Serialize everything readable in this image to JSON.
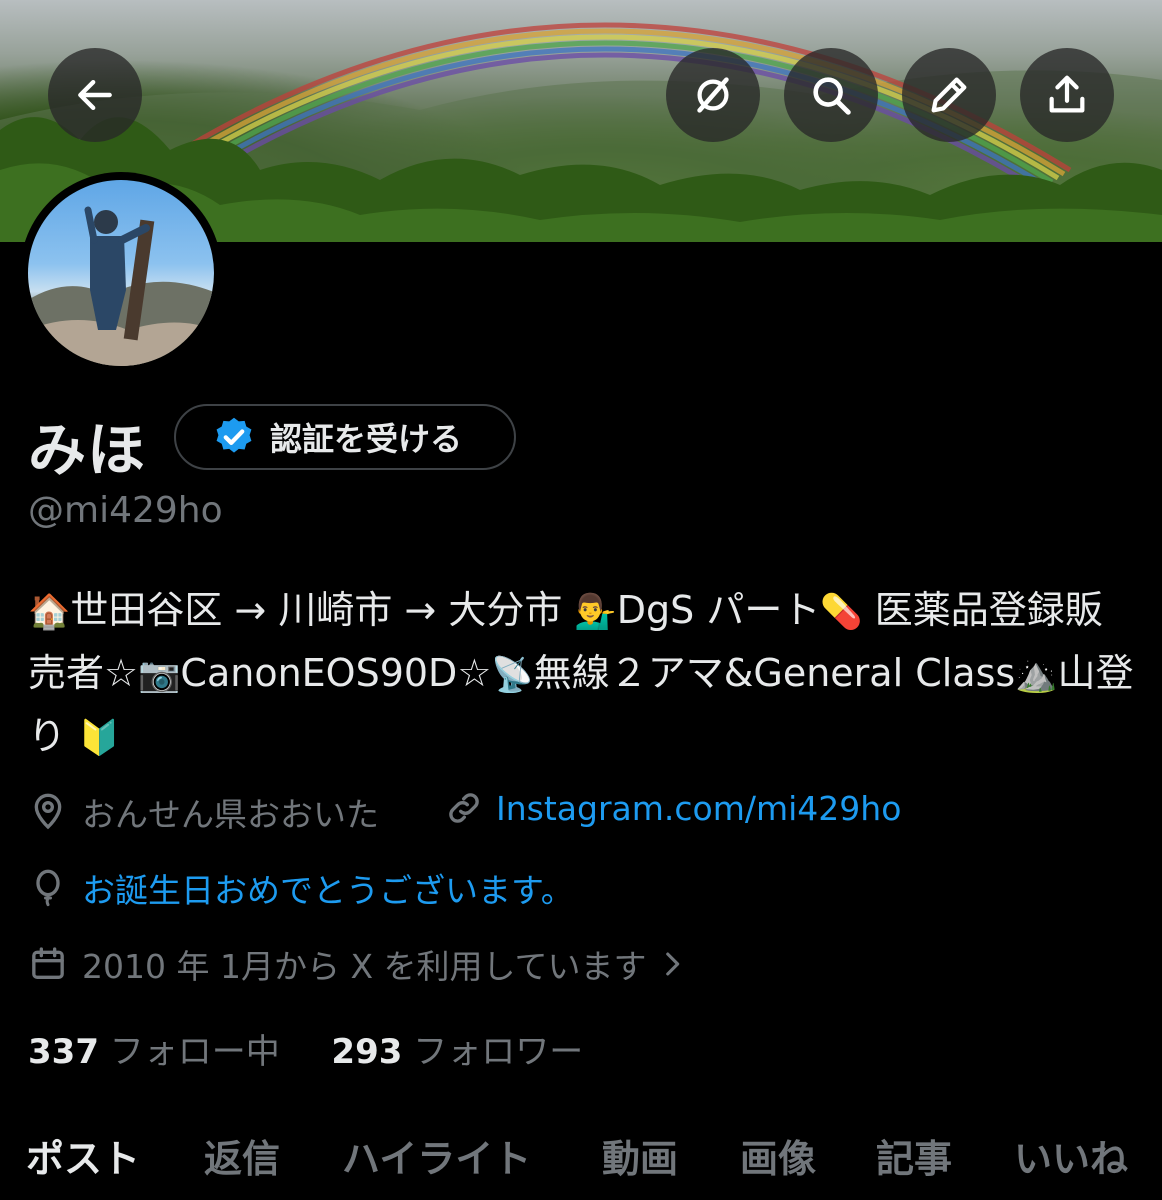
{
  "header": {
    "back_icon": "arrow-left-icon",
    "actions": [
      {
        "name": "grok-icon"
      },
      {
        "name": "search-icon"
      },
      {
        "name": "pencil-icon"
      },
      {
        "name": "share-icon"
      }
    ]
  },
  "profile": {
    "name": "みほ",
    "verify_label": "認証を受ける",
    "handle": "@mi429ho",
    "bio": {
      "p1": "世田谷区 → 川崎市 → 大分市 ",
      "p2": "DgS パート",
      "p3": " 医薬品登録販売者☆",
      "p4": "CanonEOS90D☆",
      "p5": "無線２アマ&General Class",
      "p6": "山登り ",
      "emoji": [
        "🏠",
        "💁‍♂️",
        "💊",
        "📷",
        "📡",
        "⛰️",
        "🔰"
      ]
    },
    "location": "おんせん県おおいた",
    "link": "Instagram.com/mi429ho",
    "birthday": "お誕生日おめでとうございます。",
    "joined": "2010 年 1月から X を利用しています",
    "following_count": "337",
    "following_label": "フォロー中",
    "followers_count": "293",
    "followers_label": "フォロワー"
  },
  "tabs": [
    "ポスト",
    "返信",
    "ハイライト",
    "動画",
    "画像",
    "記事",
    "いいね"
  ],
  "colors": {
    "background": "#000000",
    "text": "#e7e9ea",
    "secondary": "#71767b",
    "accent": "#1d9bf0"
  }
}
